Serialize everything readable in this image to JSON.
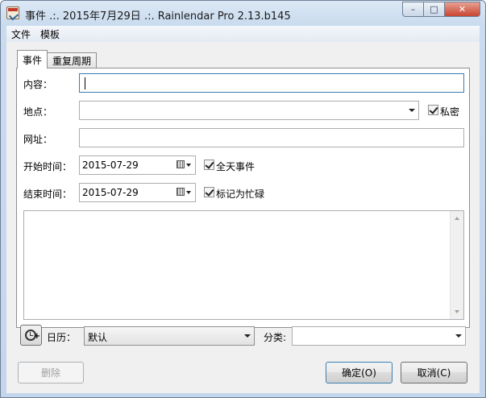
{
  "window": {
    "title": "事件 .:. 2015年7月29日 .:. Rainlendar Pro 2.13.b145",
    "min_glyph": "–",
    "max_glyph": "□",
    "close_glyph": "✕"
  },
  "menu": {
    "items": [
      "文件",
      "模板"
    ]
  },
  "tabs": [
    "事件",
    "重复周期"
  ],
  "form": {
    "content_label": "内容：",
    "content_value": "",
    "location_label": "地点：",
    "location_value": "",
    "private_label": "私密",
    "private_checked": true,
    "url_label": "网址：",
    "url_value": "",
    "start_label": "开始时间：",
    "start_date": "2015-07-29",
    "allday_label": "全天事件",
    "allday_checked": true,
    "end_label": "结束时间：",
    "end_date": "2015-07-29",
    "busy_label": "标记为忙碌",
    "busy_checked": true,
    "notes_value": ""
  },
  "bottom": {
    "calendar_label": "日历：",
    "calendar_value": "默认",
    "category_label": "分类:",
    "category_value": ""
  },
  "buttons": {
    "delete": "删除",
    "ok": "确定(O)",
    "cancel": "取消(C)"
  }
}
